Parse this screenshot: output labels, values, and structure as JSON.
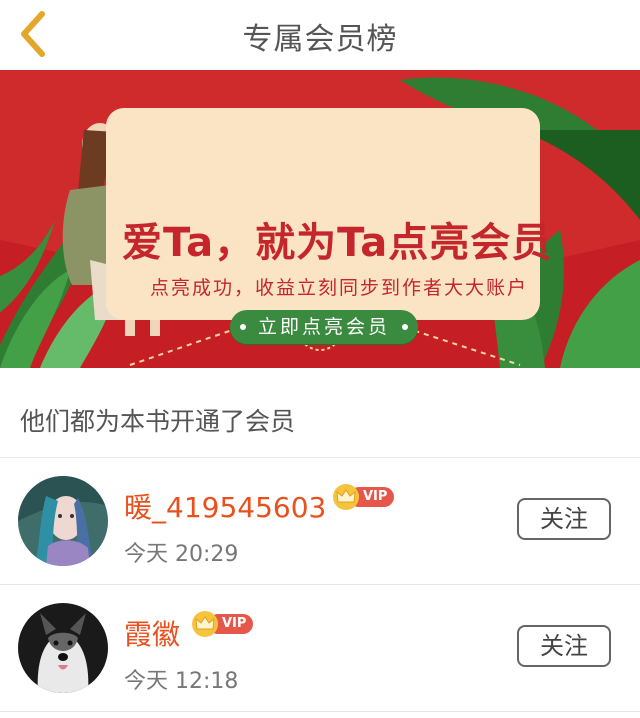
{
  "header": {
    "title": "专属会员榜",
    "back_icon": "chevron-left-icon",
    "accent_color": "#e3a82b"
  },
  "banner": {
    "headline": "爱Ta，就为Ta点亮会员",
    "subtitle": "点亮成功，收益立刻同步到作者大大账户",
    "cta_label": "立即点亮会员",
    "background_color": "#c51e24",
    "cta_color": "#3a8a3f"
  },
  "section": {
    "title": "他们都为本书开通了会员"
  },
  "members": [
    {
      "name": "暖_419545603",
      "badge": "VIP",
      "time": "今天 20:29",
      "follow_label": "关注"
    },
    {
      "name": "霞徽",
      "badge": "VIP",
      "time": "今天 12:18",
      "follow_label": "关注"
    }
  ]
}
